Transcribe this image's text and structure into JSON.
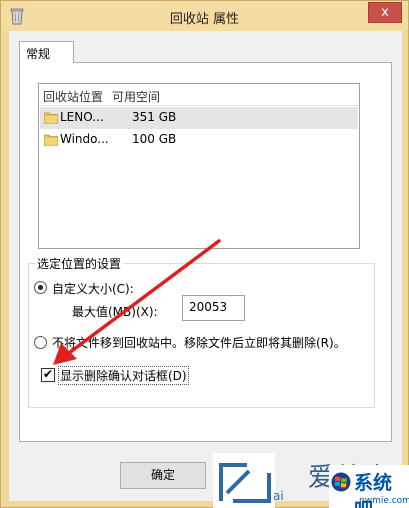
{
  "window": {
    "title": "回收站 属性",
    "close_glyph": "x"
  },
  "tabs": [
    {
      "label": "常规",
      "active": true
    }
  ],
  "listview": {
    "columns": [
      "回收站位置",
      "可用空间"
    ],
    "rows": [
      {
        "name": "LENO...",
        "free": "351 GB",
        "selected": true
      },
      {
        "name": "Windo...",
        "free": "100 GB",
        "selected": false
      }
    ]
  },
  "settings_group": {
    "label": "选定位置的设置",
    "custom_size_label": "自定义大小(C):",
    "max_value_label": "最大值(MB)(X):",
    "max_value": "20053",
    "no_move_label": "不将文件移到回收站中。移除文件后立即将其删除(R)。",
    "custom_size_selected": true
  },
  "confirm_delete": {
    "label": "显示删除确认对话框(D)",
    "checked": true,
    "check_glyph": "✔"
  },
  "buttons": {
    "ok_label": "确定"
  },
  "watermark": {
    "site_cn": "系统吧",
    "url": "nwmie.com",
    "partial_text": "爱纯净",
    "ai_text": "ai"
  },
  "colors": {
    "window_frame": "#f2d79b",
    "close_button": "#c7514a",
    "annotation_arrow": "#e02020",
    "folder": "#e8c45a"
  }
}
